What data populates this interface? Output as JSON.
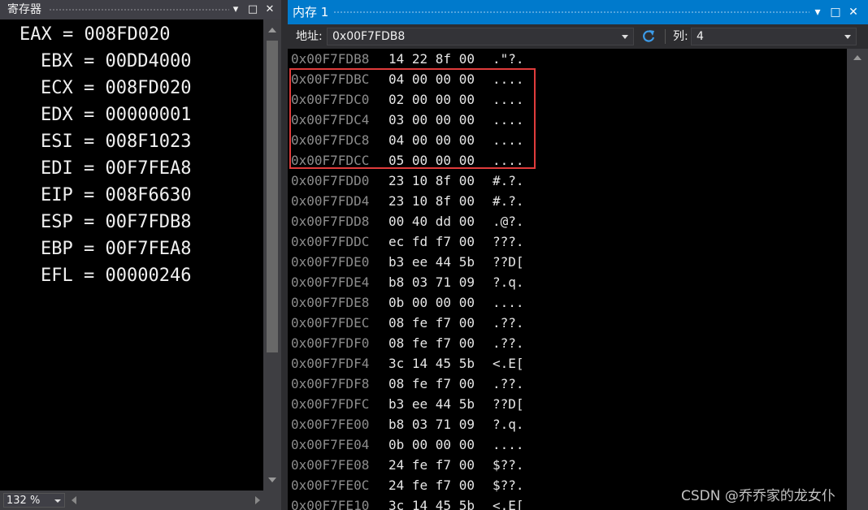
{
  "registers_panel": {
    "title": "寄存器",
    "registers": [
      {
        "name": "EAX",
        "value": "008FD020"
      },
      {
        "name": "EBX",
        "value": "00DD4000"
      },
      {
        "name": "ECX",
        "value": "008FD020"
      },
      {
        "name": "EDX",
        "value": "00000001"
      },
      {
        "name": "ESI",
        "value": "008F1023"
      },
      {
        "name": "EDI",
        "value": "00F7FEA8"
      },
      {
        "name": "EIP",
        "value": "008F6630"
      },
      {
        "name": "ESP",
        "value": "00F7FDB8"
      },
      {
        "name": "EBP",
        "value": "00F7FEA8"
      },
      {
        "name": "EFL",
        "value": "00000246"
      }
    ],
    "zoom": "132 %"
  },
  "memory_panel": {
    "title": "内存 1",
    "address_label": "地址:",
    "address_value": "0x00F7FDB8",
    "columns_label": "列:",
    "columns_value": "4",
    "rows": [
      {
        "addr": "0x00F7FDB8",
        "bytes": "14 22 8f 00",
        "ascii": ".\"?."
      },
      {
        "addr": "0x00F7FDBC",
        "bytes": "04 00 00 00",
        "ascii": "...."
      },
      {
        "addr": "0x00F7FDC0",
        "bytes": "02 00 00 00",
        "ascii": "...."
      },
      {
        "addr": "0x00F7FDC4",
        "bytes": "03 00 00 00",
        "ascii": "...."
      },
      {
        "addr": "0x00F7FDC8",
        "bytes": "04 00 00 00",
        "ascii": "...."
      },
      {
        "addr": "0x00F7FDCC",
        "bytes": "05 00 00 00",
        "ascii": "...."
      },
      {
        "addr": "0x00F7FDD0",
        "bytes": "23 10 8f 00",
        "ascii": "#.?."
      },
      {
        "addr": "0x00F7FDD4",
        "bytes": "23 10 8f 00",
        "ascii": "#.?."
      },
      {
        "addr": "0x00F7FDD8",
        "bytes": "00 40 dd 00",
        "ascii": ".@?."
      },
      {
        "addr": "0x00F7FDDC",
        "bytes": "ec fd f7 00",
        "ascii": "???."
      },
      {
        "addr": "0x00F7FDE0",
        "bytes": "b3 ee 44 5b",
        "ascii": "??D["
      },
      {
        "addr": "0x00F7FDE4",
        "bytes": "b8 03 71 09",
        "ascii": "?.q."
      },
      {
        "addr": "0x00F7FDE8",
        "bytes": "0b 00 00 00",
        "ascii": "...."
      },
      {
        "addr": "0x00F7FDEC",
        "bytes": "08 fe f7 00",
        "ascii": ".??."
      },
      {
        "addr": "0x00F7FDF0",
        "bytes": "08 fe f7 00",
        "ascii": ".??."
      },
      {
        "addr": "0x00F7FDF4",
        "bytes": "3c 14 45 5b",
        "ascii": "<.E["
      },
      {
        "addr": "0x00F7FDF8",
        "bytes": "08 fe f7 00",
        "ascii": ".??."
      },
      {
        "addr": "0x00F7FDFC",
        "bytes": "b3 ee 44 5b",
        "ascii": "??D["
      },
      {
        "addr": "0x00F7FE00",
        "bytes": "b8 03 71 09",
        "ascii": "?.q."
      },
      {
        "addr": "0x00F7FE04",
        "bytes": "0b 00 00 00",
        "ascii": "...."
      },
      {
        "addr": "0x00F7FE08",
        "bytes": "24 fe f7 00",
        "ascii": "$??."
      },
      {
        "addr": "0x00F7FE0C",
        "bytes": "24 fe f7 00",
        "ascii": "$??."
      },
      {
        "addr": "0x00F7FE10",
        "bytes": "3c 14 45 5b",
        "ascii": "<.E["
      }
    ]
  },
  "window_buttons": {
    "dropdown": "▾",
    "maximize": "□",
    "close": "✕"
  },
  "colors": {
    "accent": "#007acc",
    "highlight_box": "#e03c3c",
    "address_text": "#8c8c8c"
  },
  "watermark": "CSDN @乔乔家的龙女仆"
}
